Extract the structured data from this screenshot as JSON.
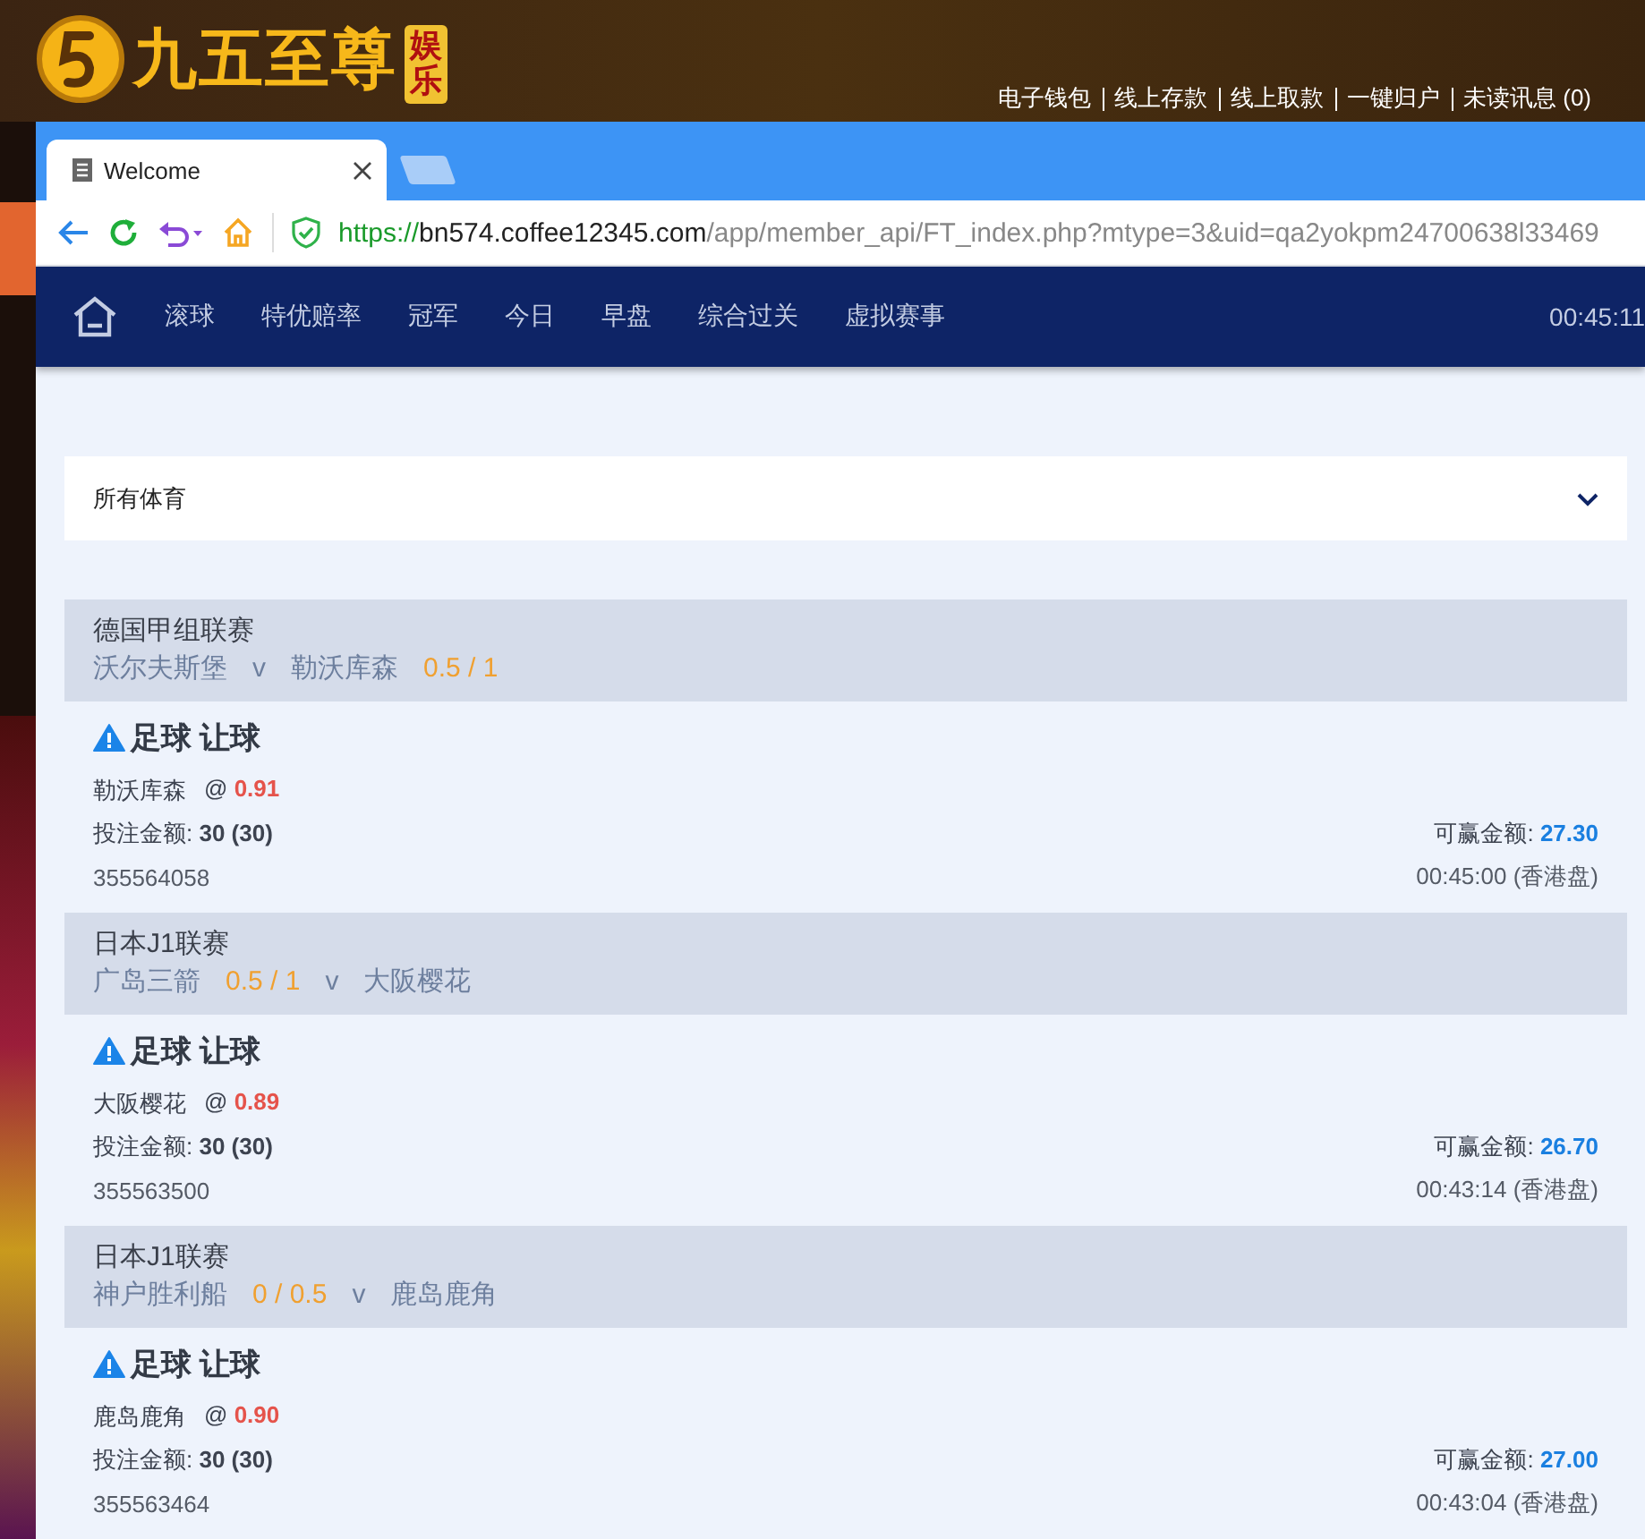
{
  "site": {
    "logo_text": "九五至尊",
    "logo_badge": "娱乐",
    "links": [
      "电子钱包",
      "线上存款",
      "线上取款",
      "一键归户",
      "未读讯息 (0)"
    ]
  },
  "browser": {
    "tab_title": "Welcome",
    "url_scheme": "https://",
    "url_host": "bn574.coffee12345.com",
    "url_path": "/app/member_api/FT_index.php?mtype=3&uid=qa2yokpm24700638l33469"
  },
  "nav": {
    "items": [
      "滚球",
      "特优赔率",
      "冠军",
      "今日",
      "早盘",
      "综合过关",
      "虚拟赛事"
    ],
    "clock": "00:45:11"
  },
  "filter": {
    "value": "所有体育"
  },
  "bets": [
    {
      "league": "德国甲组联赛",
      "line": [
        {
          "kind": "team",
          "text": "沃尔夫斯堡"
        },
        {
          "kind": "vs",
          "text": "v"
        },
        {
          "kind": "team",
          "text": "勒沃库森"
        },
        {
          "kind": "handicap",
          "text": "0.5 / 1"
        }
      ],
      "market": "足球 让球",
      "pick": "勒沃库森",
      "at": "@",
      "odds": "0.91",
      "stake_label": "投注金额:",
      "stake": "30 (30)",
      "win_label": "可赢金额:",
      "win": "27.30",
      "ticket": "355564058",
      "time": "00:45:00 (香港盘)"
    },
    {
      "league": "日本J1联赛",
      "line": [
        {
          "kind": "team",
          "text": "广岛三箭"
        },
        {
          "kind": "handicap",
          "text": "0.5 / 1"
        },
        {
          "kind": "vs",
          "text": "v"
        },
        {
          "kind": "team",
          "text": "大阪樱花"
        }
      ],
      "market": "足球 让球",
      "pick": "大阪樱花",
      "at": "@",
      "odds": "0.89",
      "stake_label": "投注金额:",
      "stake": "30 (30)",
      "win_label": "可赢金额:",
      "win": "26.70",
      "ticket": "355563500",
      "time": "00:43:14 (香港盘)"
    },
    {
      "league": "日本J1联赛",
      "line": [
        {
          "kind": "team",
          "text": "神户胜利船"
        },
        {
          "kind": "handicap",
          "text": "0 / 0.5"
        },
        {
          "kind": "vs",
          "text": "v"
        },
        {
          "kind": "team",
          "text": "鹿岛鹿角"
        }
      ],
      "market": "足球 让球",
      "pick": "鹿岛鹿角",
      "at": "@",
      "odds": "0.90",
      "stake_label": "投注金额:",
      "stake": "30 (30)",
      "win_label": "可赢金额:",
      "win": "27.00",
      "ticket": "355563464",
      "time": "00:43:04 (香港盘)"
    }
  ]
}
